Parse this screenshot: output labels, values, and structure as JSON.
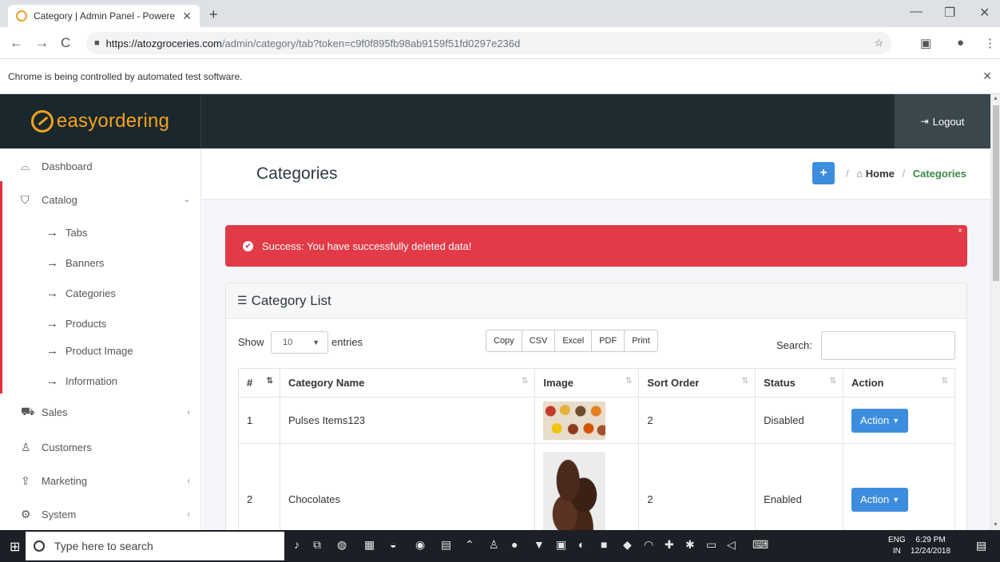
{
  "browser": {
    "tab_title": "Category | Admin Panel - Powere",
    "tab_close": "✕",
    "new_tab": "+",
    "window_minimize": "—",
    "window_restore": "❐",
    "window_close": "✕",
    "back": "←",
    "forward": "→",
    "reload": "C",
    "url_host": "https://atozgroceries.com",
    "url_path": "/admin/category/tab?token=c9f0f895fb98ab9159f51fd0297e236d",
    "infobar_text": "Chrome is being controlled by automated test software.",
    "infobar_close": "✕"
  },
  "header": {
    "logo_text": "easyordering",
    "logout_label": "Logout"
  },
  "sidebar": {
    "items": [
      {
        "label": "Dashboard",
        "icon": "dashboard-icon",
        "glyph": "⌓"
      },
      {
        "label": "Catalog",
        "icon": "tag-icon",
        "glyph": "⛉",
        "chevron": "⌄"
      },
      {
        "label": "Sales",
        "icon": "cart-icon",
        "glyph": "⛟",
        "chevron": "‹"
      },
      {
        "label": "Customers",
        "icon": "user-icon",
        "glyph": "♙"
      },
      {
        "label": "Marketing",
        "icon": "share-icon",
        "glyph": "⇪",
        "chevron": "‹"
      },
      {
        "label": "System",
        "icon": "gear-icon",
        "glyph": "⚙",
        "chevron": "‹"
      }
    ],
    "catalog_children": [
      "Tabs",
      "Banners",
      "Categories",
      "Products",
      "Product Image",
      "Information"
    ],
    "arrow": "→"
  },
  "page": {
    "title": "Categories",
    "add_label": "+",
    "breadcrumb_sep": "/",
    "breadcrumb_home": "Home",
    "breadcrumb_current": "Categories"
  },
  "alert": {
    "text": "Success: You have successfully deleted data!",
    "check": "✔",
    "close": "×",
    "color": "#e23a46"
  },
  "card": {
    "title": "Category List",
    "show_label": "Show",
    "length_value": "10",
    "entries_label": "entries",
    "export_buttons": [
      "Copy",
      "CSV",
      "Excel",
      "PDF",
      "Print"
    ],
    "search_label": "Search:",
    "search_value": ""
  },
  "table": {
    "columns": [
      "#",
      "Category Name",
      "Image",
      "Sort Order",
      "Status",
      "Action"
    ],
    "rows": [
      {
        "id": "1",
        "name": "Pulses Items123",
        "image": "pulses-thumbnail",
        "sort_order": "2",
        "status": "Disabled",
        "action": "Action"
      },
      {
        "id": "2",
        "name": "Chocolates",
        "image": "chocolates-thumbnail",
        "sort_order": "2",
        "status": "Enabled",
        "action": "Action"
      }
    ]
  },
  "taskbar": {
    "search_placeholder": "Type here to search",
    "lang_top": "ENG",
    "lang_bottom": "IN",
    "time": "6:29 PM",
    "date": "12/24/2018"
  },
  "colors": {
    "accent_blue": "#3c8dde",
    "header_dark": "#1f2d33",
    "logo_orange": "#f4a21d",
    "crumb_green": "#3a8a44"
  }
}
